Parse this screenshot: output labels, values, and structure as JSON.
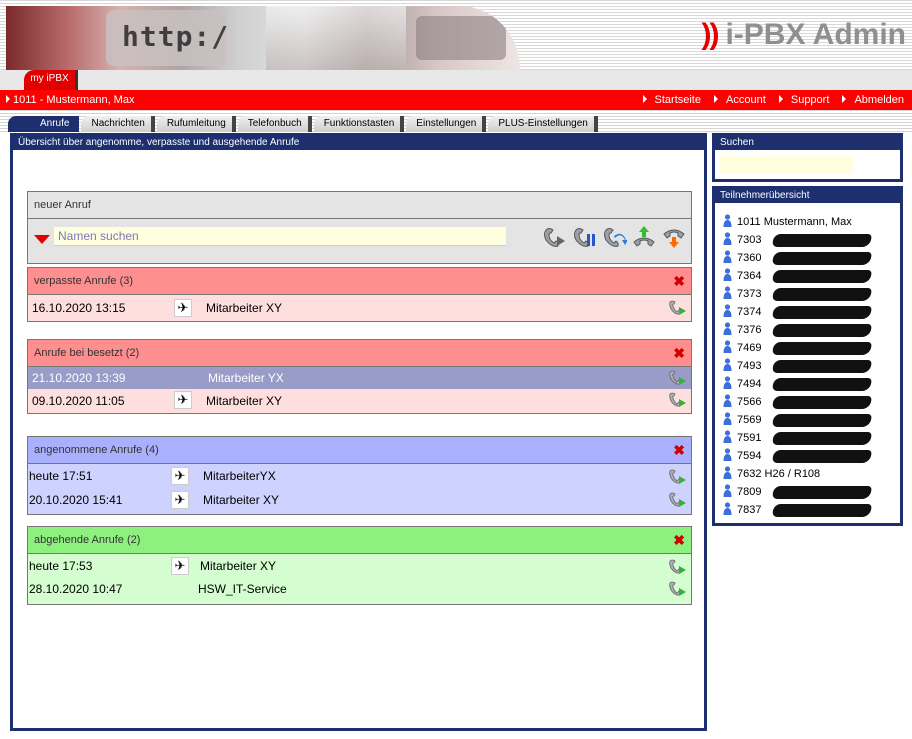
{
  "header": {
    "banner_text": "http:/",
    "brand_mark": "))",
    "brand_title": "i-PBX Admin"
  },
  "top_tab": {
    "label": "my iPBX"
  },
  "userbar": {
    "user": "1011 - Mustermann, Max",
    "links": [
      "Startseite",
      "Account",
      "Support",
      "Abmelden"
    ]
  },
  "tabs": [
    "Anrufe",
    "Nachrichten",
    "Rufumleitung",
    "Telefonbuch",
    "Funktionstasten",
    "Einstellungen",
    "PLUS-Einstellungen"
  ],
  "main": {
    "heading": "Übersicht über angenomme, verpasste und ausgehende Anrufe",
    "new_call": {
      "title": "neuer Anruf",
      "placeholder": "Namen suchen"
    },
    "missed": {
      "title": "verpasste Anrufe (3)",
      "rows": [
        {
          "datetime": "16.10.2020 13:15",
          "name": "Mitarbeiter XY"
        }
      ]
    },
    "busy": {
      "title": "Anrufe bei besetzt (2)",
      "rows": [
        {
          "datetime": "21.10.2020 13:39",
          "name": "Mitarbeiter YX"
        },
        {
          "datetime": "09.10.2020 11:05",
          "name": "Mitarbeiter XY"
        }
      ]
    },
    "accepted": {
      "title": "angenommene Anrufe (4)",
      "rows": [
        {
          "datetime": "heute 17:51",
          "name": "MitarbeiterYX"
        },
        {
          "datetime": "20.10.2020 15:41",
          "name": "Mitarbeiter XY"
        }
      ]
    },
    "outgoing": {
      "title": "abgehende Anrufe (2)",
      "rows": [
        {
          "datetime": "heute 17:53",
          "name": "Mitarbeiter XY"
        },
        {
          "datetime": "28.10.2020 10:47",
          "name": "HSW_IT-Service"
        }
      ]
    },
    "close_glyph": "✖"
  },
  "sidebar": {
    "search_title": "Suchen",
    "participants_title": "Teilnehmerübersicht",
    "participants": [
      {
        "label": "1011 Mustermann, Max",
        "redacted": false
      },
      {
        "label": "7303",
        "redacted": true
      },
      {
        "label": "7360",
        "redacted": true
      },
      {
        "label": "7364",
        "redacted": true
      },
      {
        "label": "7373",
        "redacted": true
      },
      {
        "label": "7374",
        "redacted": true
      },
      {
        "label": "7376",
        "redacted": true
      },
      {
        "label": "7469",
        "redacted": true
      },
      {
        "label": "7493",
        "redacted": true
      },
      {
        "label": "7494",
        "redacted": true
      },
      {
        "label": "7566",
        "redacted": true
      },
      {
        "label": "7569",
        "redacted": true
      },
      {
        "label": "7591",
        "redacted": true
      },
      {
        "label": "7594",
        "redacted": true
      },
      {
        "label": "7632 H26 / R108",
        "redacted": false
      },
      {
        "label": "7809",
        "redacted": true
      },
      {
        "label": "7837",
        "redacted": true
      }
    ]
  },
  "colors": {
    "navy": "#1d2f6e",
    "red": "#ff0000",
    "missed_header": "#ff8e8e",
    "accepted_header": "#a9b1ff",
    "outgoing_header": "#8ef07f",
    "selected_row": "#9a9cc8"
  },
  "icons": {
    "toolbar": [
      "call-icon",
      "hold-icon",
      "transfer-icon",
      "pickup-icon",
      "hangup-icon"
    ],
    "row_type": "hand-icon",
    "row_action": "call-back-icon",
    "participant": "person-icon"
  }
}
